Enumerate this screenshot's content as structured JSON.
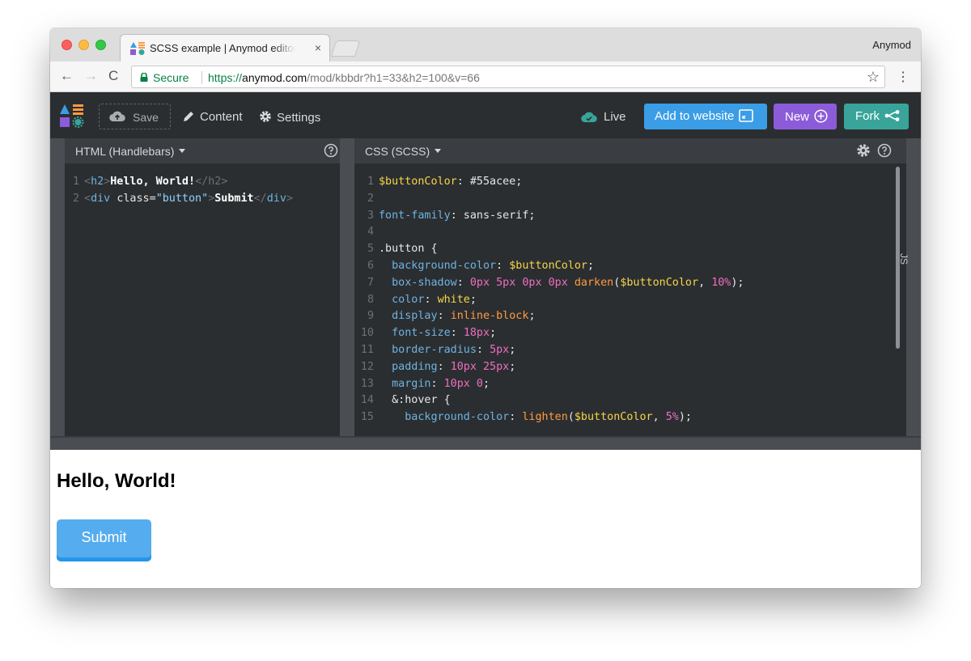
{
  "browser": {
    "tab_title": "SCSS example | Anymod editor",
    "tab_close": "×",
    "profile_name": "Anymod",
    "secure_label": "Secure",
    "url_scheme": "https://",
    "url_host": "anymod.com",
    "url_path": "/mod/kbbdr?h1=33&h2=100&v=66",
    "back_glyph": "←",
    "forward_glyph": "→",
    "reload_glyph": "C",
    "star_glyph": "☆",
    "menu_glyph": "⋮",
    "colors": {
      "secure": "#0b8043"
    }
  },
  "app_header": {
    "save_label": "Save",
    "content_label": "Content",
    "settings_label": "Settings",
    "live_label": "Live",
    "add_to_website_label": "Add to website",
    "new_label": "New",
    "fork_label": "Fork",
    "colors": {
      "add": "#3a9de6",
      "new": "#8c5bd9",
      "fork": "#38a49a",
      "live_cloud": "#38a49a"
    }
  },
  "html_editor": {
    "title": "HTML (Handlebars)",
    "lines": [
      {
        "n": "1",
        "open_tag": "h2",
        "text": "Hello, World!",
        "close_tag": "h2"
      },
      {
        "n": "2",
        "open_tag": "div",
        "attr": "class",
        "value": "\"button\"",
        "text": "Submit",
        "close_tag": "div"
      }
    ]
  },
  "css_editor": {
    "title": "CSS (SCSS)",
    "side_tab": "JS",
    "lines": [
      {
        "n": "1"
      },
      {
        "n": "2"
      },
      {
        "n": "3"
      },
      {
        "n": "4"
      },
      {
        "n": "5"
      },
      {
        "n": "6"
      },
      {
        "n": "7"
      },
      {
        "n": "8"
      },
      {
        "n": "9"
      },
      {
        "n": "10"
      },
      {
        "n": "11"
      },
      {
        "n": "12"
      },
      {
        "n": "13"
      },
      {
        "n": "14"
      },
      {
        "n": "15"
      }
    ],
    "code": {
      "l1_var": "$buttonColor",
      "l1_colon": ":",
      "l1_val": " #55acee;",
      "l3_prop": "font-family",
      "l3_val": ": sans-serif;",
      "l5_sel": ".button {",
      "l6_prop": "background-color",
      "l6_var": "$buttonColor",
      "l7_prop": "box-shadow",
      "l7_nums": "0px 5px 0px 0px",
      "l7_fn": "darken",
      "l7_var": "$buttonColor",
      "l7_pct": "10%",
      "l8_prop": "color",
      "l8_val": "white",
      "l9_prop": "display",
      "l9_val": "inline-block",
      "l10_prop": "font-size",
      "l10_val": "18px",
      "l11_prop": "border-radius",
      "l11_val": "5px",
      "l12_prop": "padding",
      "l12_val": "10px 25px",
      "l13_prop": "margin",
      "l13_val": "10px 0",
      "l14_sel": "&:hover {",
      "l15_prop": "background-color",
      "l15_fn": "lighten",
      "l15_var": "$buttonColor",
      "l15_pct": "5%"
    }
  },
  "preview": {
    "heading": "Hello, World!",
    "button_label": "Submit",
    "colors": {
      "button": "#55acee",
      "button_shadow": "#2795e9"
    }
  }
}
